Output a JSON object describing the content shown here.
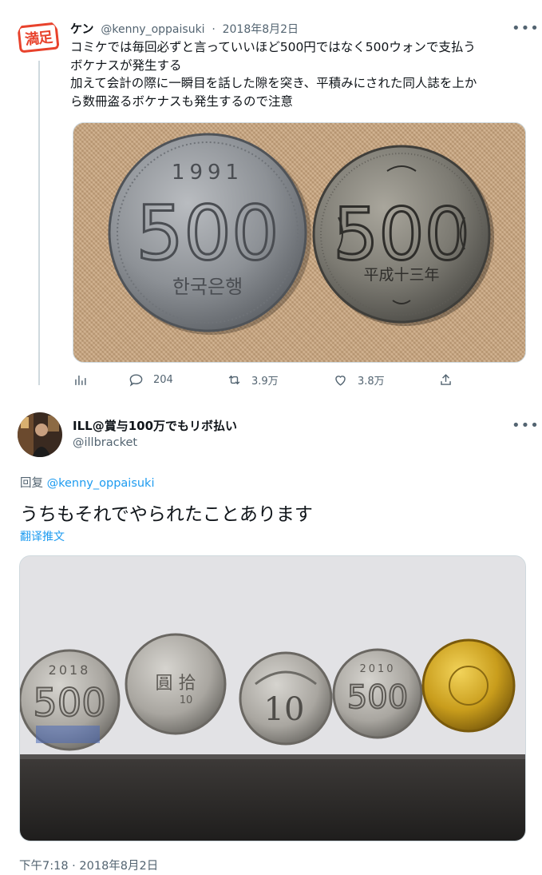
{
  "parent_tweet": {
    "avatar_text": "満足",
    "display_name": "ケン",
    "handle": "@kenny_oppaisuki",
    "separator": "·",
    "date": "2018年8月2日",
    "text_lines": [
      "コミケでは毎回必ずと言っていいほど500円ではなく500ウォンで支払う",
      "ボケナスが発生する",
      "加えて会計の際に一瞬目を話した隙を突き、平積みにされた同人誌を上か",
      "ら数冊盗るボケナスも発生するので注意"
    ],
    "image": {
      "left_coin": {
        "year": "1991",
        "value": "500",
        "label": "한국은행"
      },
      "right_coin": {
        "value": "500",
        "label": "平成十三年"
      }
    },
    "actions": {
      "analytics_icon": "analytics-icon",
      "reply_count": "204",
      "retweet_count": "3.9万",
      "like_count": "3.8万",
      "share_icon": "share-icon"
    }
  },
  "reply_tweet": {
    "display_name": "ILL@賞与100万でもリボ払い",
    "handle": "@illbracket",
    "replying_prefix": "回复",
    "replying_to": "@kenny_oppaisuki",
    "text": "うちもそれでやられたことあります",
    "translate_label": "翻译推文",
    "image": {
      "coins": [
        {
          "year": "2018",
          "value": "500"
        },
        {
          "value": "圓 拾",
          "sub": "10"
        },
        {
          "value": "10"
        },
        {
          "year": "2010",
          "value": "500"
        },
        {
          "value": ""
        }
      ]
    },
    "timestamp": "下午7:18 · 2018年8月2日"
  },
  "colors": {
    "text": "#0f1419",
    "secondary": "#536471",
    "link": "#1d9bf0",
    "divider": "#cfd9de",
    "badge_red": "#e8422c"
  }
}
